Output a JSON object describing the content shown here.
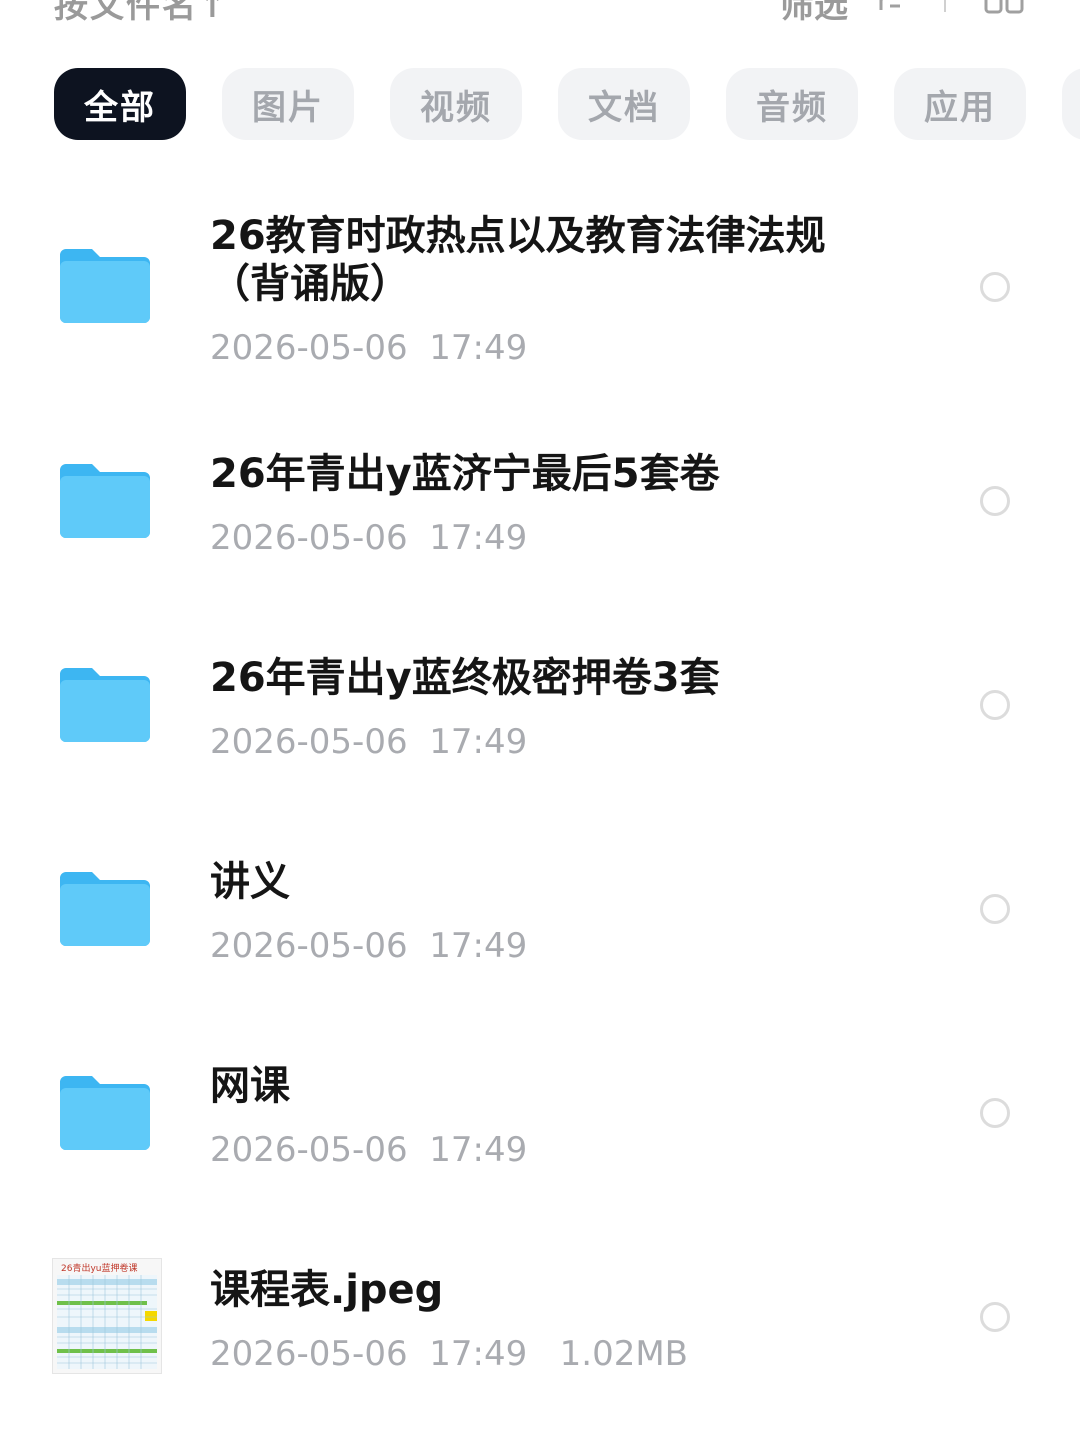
{
  "header": {
    "sort_label": "按文件名↑",
    "filter_label": "筛选"
  },
  "tabs": [
    {
      "label": "全部",
      "active": true
    },
    {
      "label": "图片",
      "active": false
    },
    {
      "label": "视频",
      "active": false
    },
    {
      "label": "文档",
      "active": false
    },
    {
      "label": "音频",
      "active": false
    },
    {
      "label": "应用",
      "active": false
    }
  ],
  "files": [
    {
      "type": "folder",
      "name": "26教育时政热点以及教育法律法规（背诵版）",
      "date": "2026-05-06",
      "time": "17:49",
      "size": ""
    },
    {
      "type": "folder",
      "name": "26年青出y蓝济宁最后5套卷",
      "date": "2026-05-06",
      "time": "17:49",
      "size": ""
    },
    {
      "type": "folder",
      "name": "26年青出y蓝终极密押卷3套",
      "date": "2026-05-06",
      "time": "17:49",
      "size": ""
    },
    {
      "type": "folder",
      "name": "讲义",
      "date": "2026-05-06",
      "time": "17:49",
      "size": ""
    },
    {
      "type": "folder",
      "name": "网课",
      "date": "2026-05-06",
      "time": "17:49",
      "size": ""
    },
    {
      "type": "image",
      "name": "课程表.jpeg",
      "date": "2026-05-06",
      "time": "17:49",
      "size": "1.02MB",
      "thumbnail_caption": "26青出yu蓝押卷课"
    }
  ],
  "colors": {
    "folder": "#4cc3f7",
    "active_tab_bg": "#0d1320",
    "tab_bg": "#f2f3f5",
    "meta_text": "#a9abb0"
  }
}
